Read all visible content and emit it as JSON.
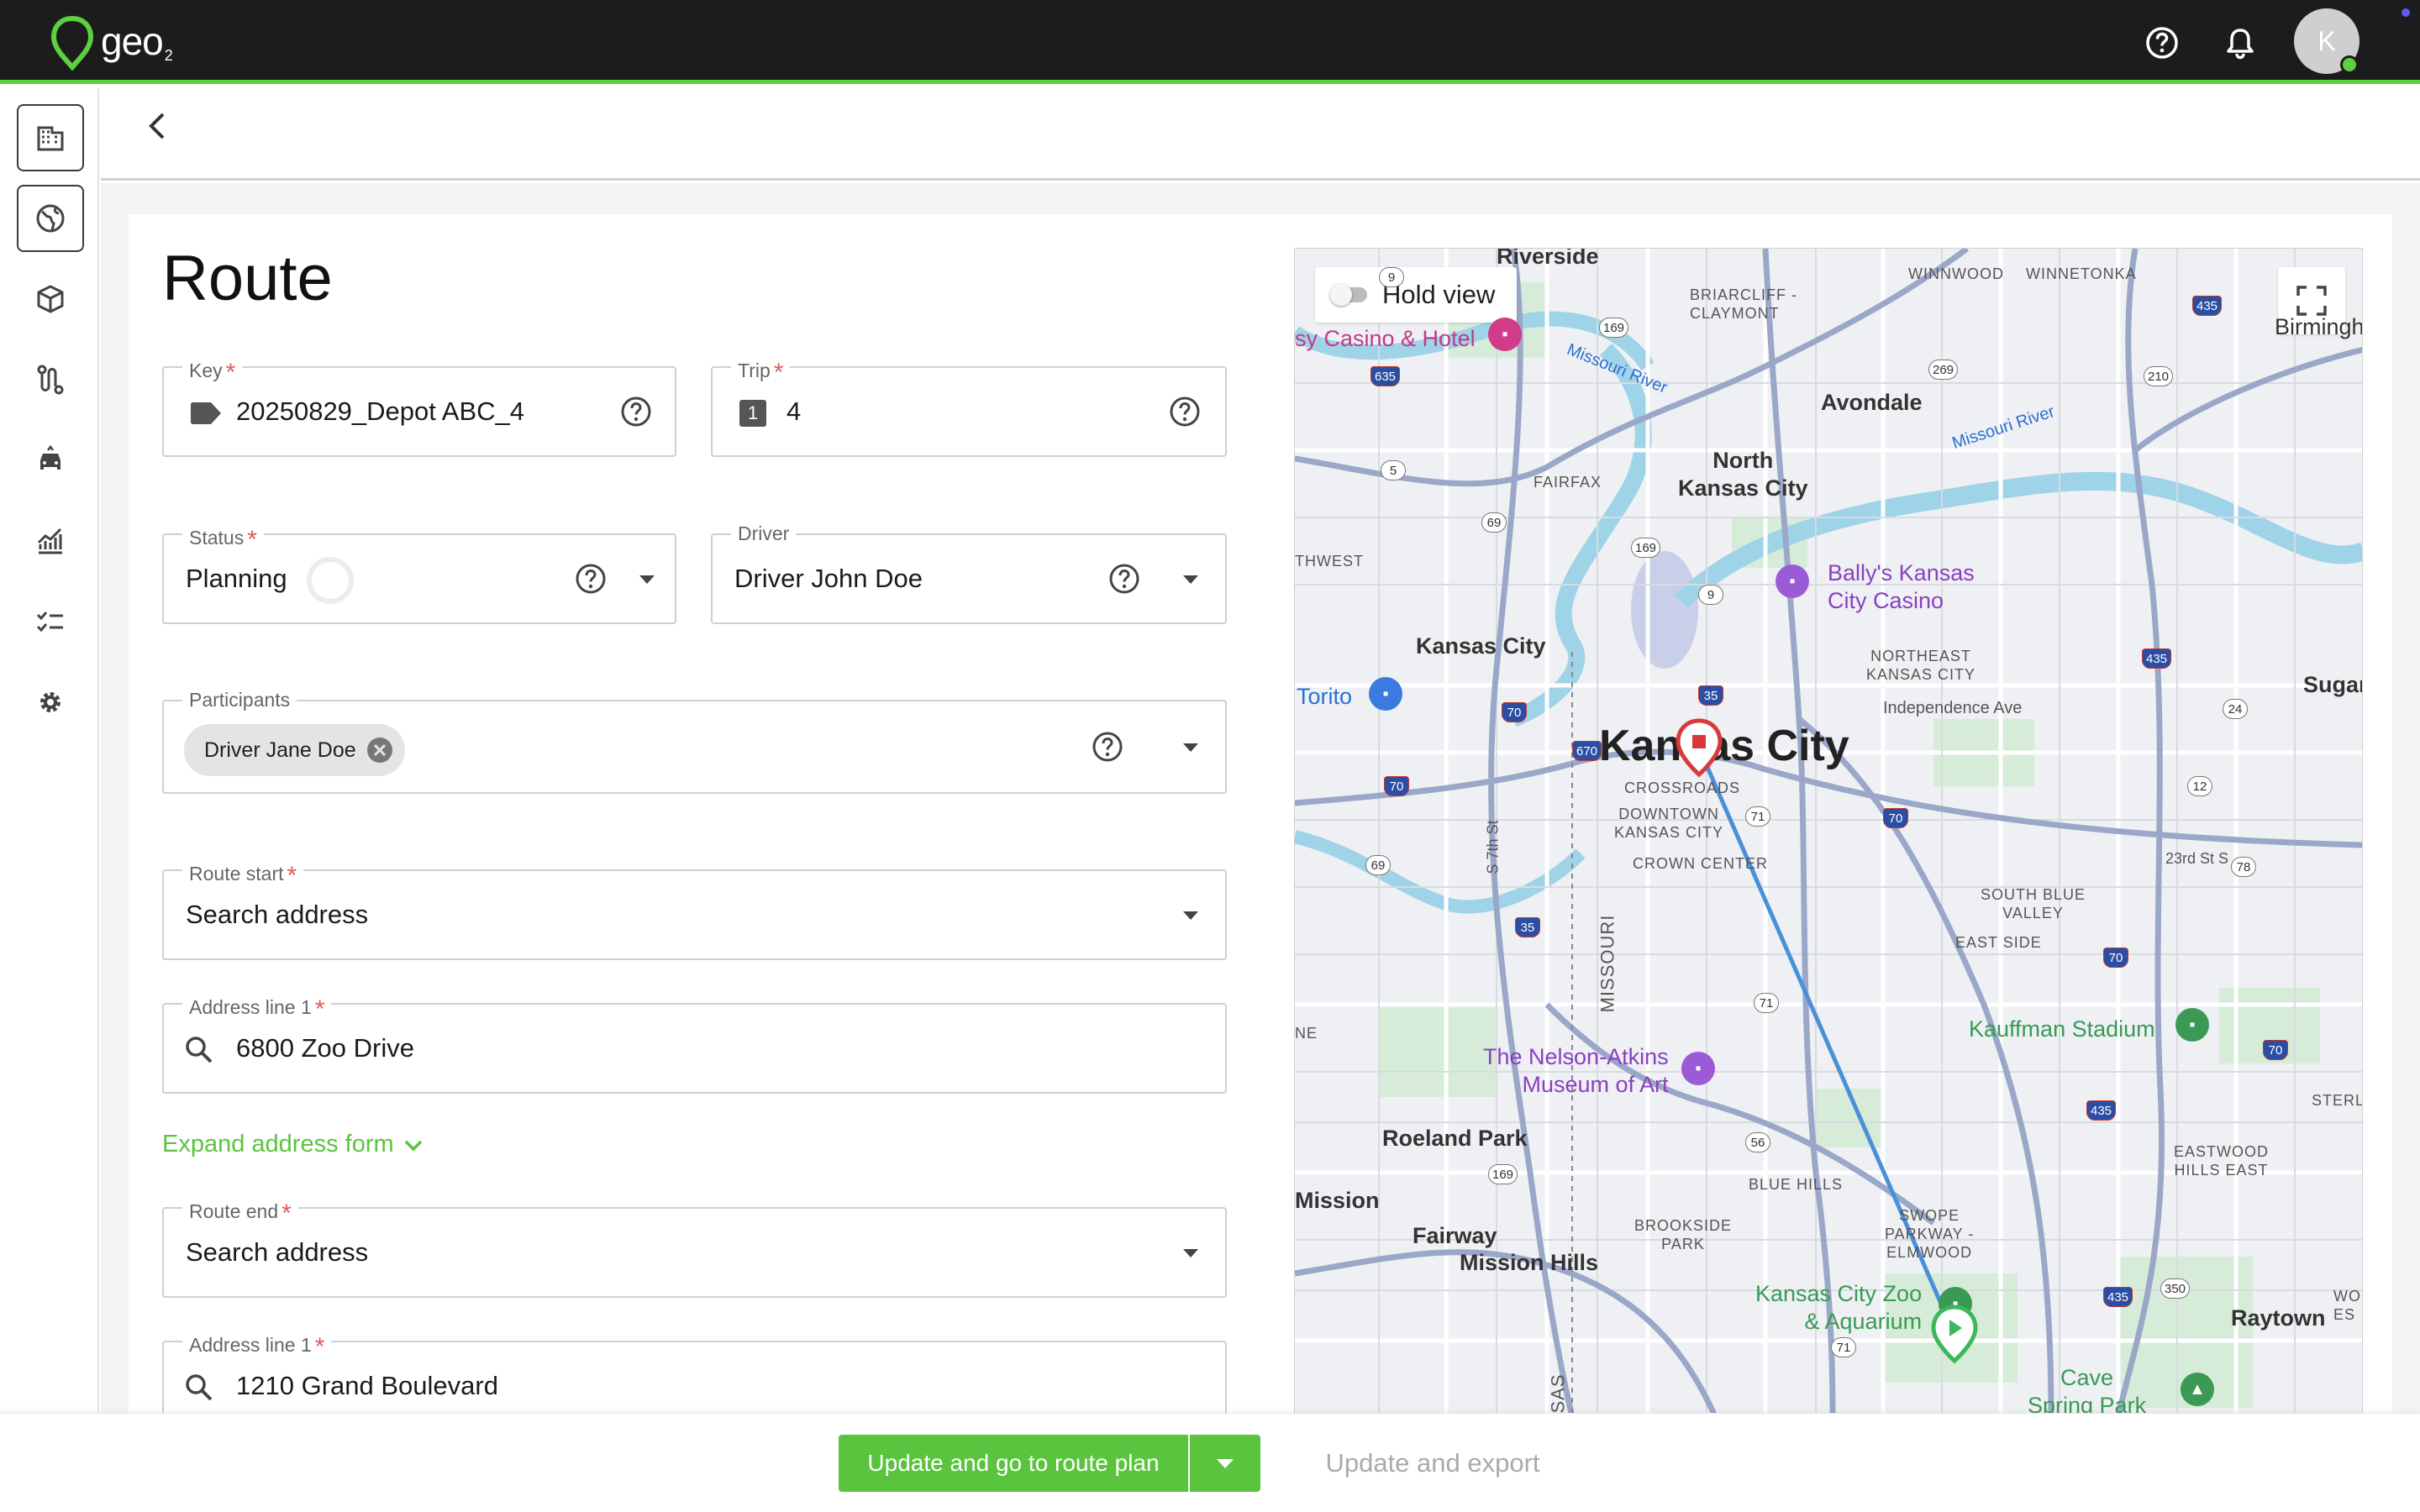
{
  "app": {
    "logo_text": "geo",
    "logo_sub": "2",
    "avatar_initial": "K"
  },
  "header": {
    "back_icon": "chevron-left-icon"
  },
  "rail": {
    "items": [
      {
        "icon": "building-icon"
      },
      {
        "icon": "globe-icon"
      },
      {
        "icon": "package-icon"
      },
      {
        "icon": "route-icon"
      },
      {
        "icon": "vehicle-icon"
      },
      {
        "icon": "analytics-icon"
      },
      {
        "icon": "checklist-icon"
      },
      {
        "icon": "settings-icon"
      }
    ]
  },
  "form": {
    "title": "Route",
    "key": {
      "label": "Key",
      "value": "20250829_Depot ABC_4",
      "icon": "tag-icon"
    },
    "trip": {
      "label": "Trip",
      "value": "4",
      "badge": "1"
    },
    "status": {
      "label": "Status",
      "value": "Planning"
    },
    "driver": {
      "label": "Driver",
      "value": "Driver John Doe"
    },
    "participants": {
      "label": "Participants",
      "chips": [
        "Driver Jane Doe"
      ]
    },
    "route_start": {
      "label": "Route start",
      "value": "Search address"
    },
    "start_address": {
      "label": "Address line 1",
      "value": "6800 Zoo Drive"
    },
    "expand_link": "Expand address form",
    "route_end": {
      "label": "Route end",
      "value": "Search address"
    },
    "end_address": {
      "label": "Address line 1",
      "value": "1210 Grand Boulevard"
    }
  },
  "map": {
    "hold_view": "Hold view",
    "labels": {
      "riverside": "Riverside",
      "casino_hotel": "sy Casino & Hotel",
      "briarcliff": "BRIARCLIFF -\nCLAYMONT",
      "winnwood": "WINNWOOD",
      "winnetonka": "WINNETONKA",
      "birmingham": "Birmingh",
      "missouri_river_1": "Missouri River",
      "missouri_river_2": "Missouri River",
      "avondale": "Avondale",
      "fairfax": "FAIRFAX",
      "north_kc": "North\nKansas City",
      "thwest": "THWEST",
      "ballys": "Bally's Kansas\nCity Casino",
      "kansas_city_ks": "Kansas City",
      "northeast_kc": "NORTHEAST\nKANSAS CITY",
      "torito": "Torito",
      "sugar": "Sugar",
      "independence_ave": "Independence Ave",
      "kansas_city_big": "Kansas City",
      "crossroads": "CROSSROADS",
      "downtown_kc": "DOWNTOWN\nKANSAS CITY",
      "crown_center": "CROWN CENTER",
      "s7th": "S 7th St",
      "street_23rd": "23rd St S",
      "south_blue_valley": "SOUTH BLUE\nVALLEY",
      "east_side": "EAST SIDE",
      "missouri_state": "MISSOURI",
      "kauffman": "Kauffman Stadium",
      "ne": "NE",
      "nelson_atkins": "The Nelson-Atkins\nMuseum of Art",
      "sterl": "STERL",
      "roeland_park": "Roeland Park",
      "eastwood_hills": "EASTWOOD\nHILLS EAST",
      "mission": "Mission",
      "blue_hills": "BLUE HILLS",
      "fairway": "Fairway",
      "mission_hills": "Mission Hills",
      "brookside": "BROOKSIDE\nPARK",
      "swope_parkway": "SWOPE\nPARKWAY -\nELMWOOD",
      "kc_zoo": "Kansas City Zoo\n& Aquarium",
      "raytown": "Raytown",
      "wo_es": "WO\nES",
      "cave_spring": "Cave\nSpring Park",
      "sas": "SAS"
    },
    "shields": [
      "9",
      "169",
      "435",
      "635",
      "269",
      "210",
      "5",
      "69",
      "169",
      "9",
      "435",
      "35",
      "70",
      "670",
      "70",
      "71",
      "70",
      "24",
      "12",
      "69",
      "78",
      "35",
      "71",
      "70",
      "435",
      "56",
      "70",
      "169",
      "435",
      "350",
      "71"
    ]
  },
  "actions": {
    "primary": "Update and go to route plan",
    "secondary": "Update and export"
  },
  "colors": {
    "accent": "#5bc43e",
    "topbar": "#1c1c1c",
    "route_line": "#4a90d9",
    "marker_start": "#3cb85a",
    "marker_end": "#d63a3a"
  }
}
